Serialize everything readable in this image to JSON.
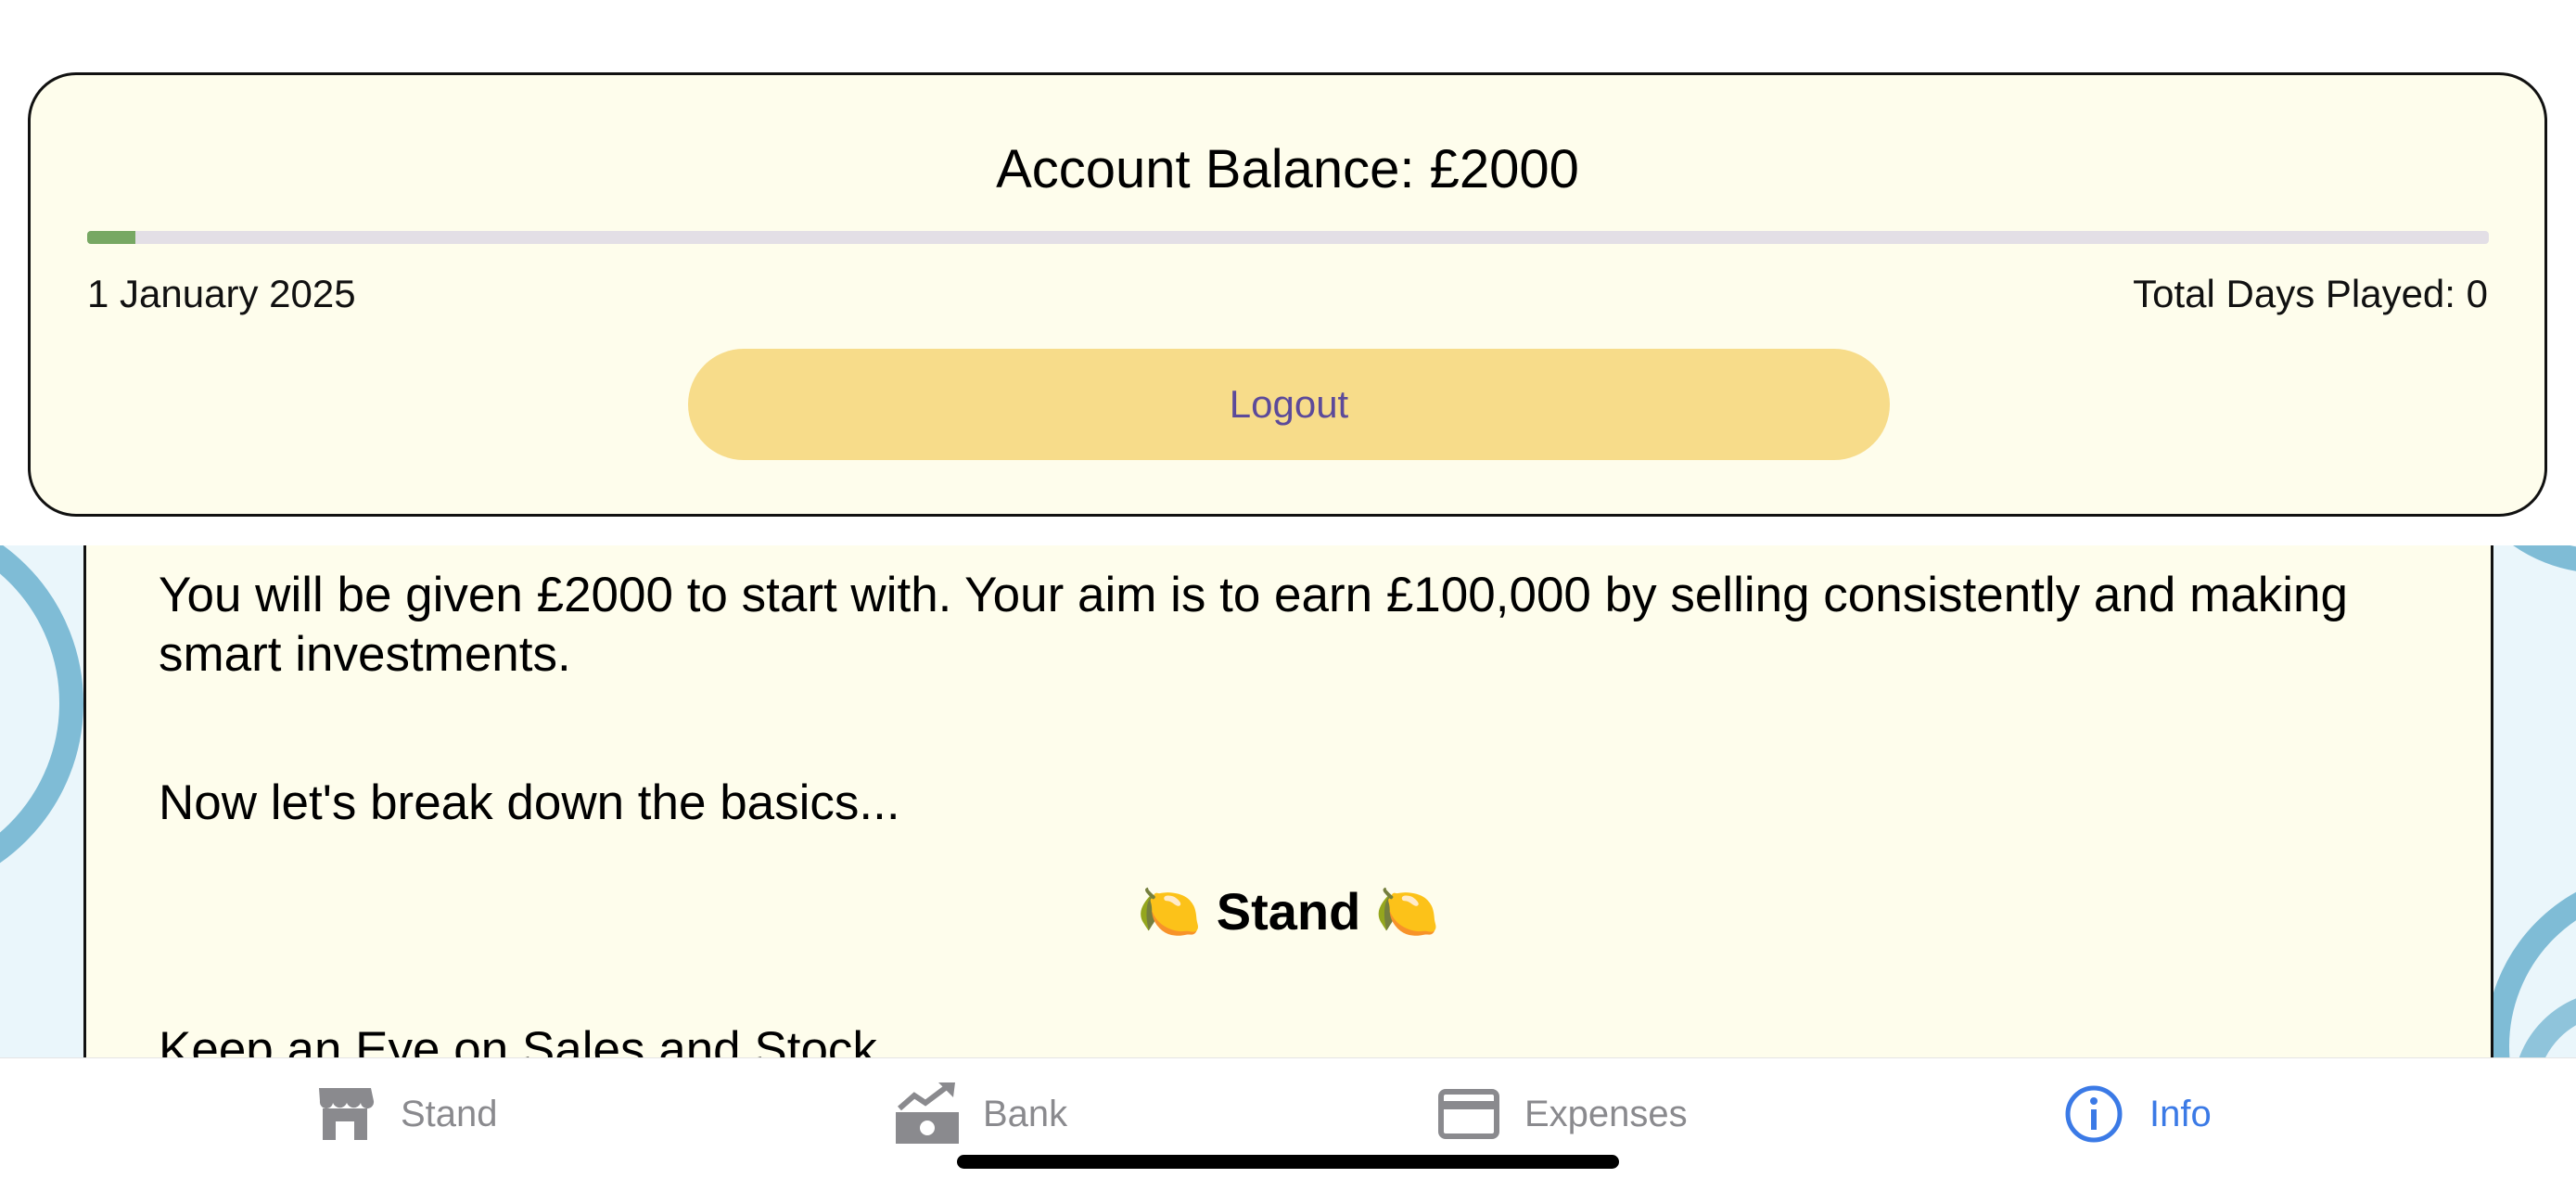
{
  "header": {
    "balance_title": "Account Balance: £2000",
    "progress_fraction": 0.02,
    "date": "1 January 2025",
    "days_played": "Total Days Played: 0",
    "logout_label": "Logout",
    "colors": {
      "card_background": "#fefdec",
      "progress_fill": "#77a863",
      "progress_track": "#e3dfe6",
      "logout_background": "#f7dc8a",
      "logout_text": "#5c4a9a"
    }
  },
  "info": {
    "intro": "You will be given £2000 to start with. Your aim is to earn £100,000 by selling consistently and making smart investments.",
    "basics": "Now let's break down the basics...",
    "section_title": "Stand",
    "section_emoji": "🍋",
    "sales_tip": "Keep an Eye on Sales and Stock"
  },
  "tabs": [
    {
      "label": "Stand",
      "icon": "storefront-icon",
      "active": false
    },
    {
      "label": "Bank",
      "icon": "money-trend-icon",
      "active": false
    },
    {
      "label": "Expenses",
      "icon": "credit-card-icon",
      "active": false
    },
    {
      "label": "Info",
      "icon": "info-circle-icon",
      "active": true
    }
  ],
  "colors": {
    "tab_inactive": "#8a8a8e",
    "tab_active": "#3b7ae6"
  }
}
